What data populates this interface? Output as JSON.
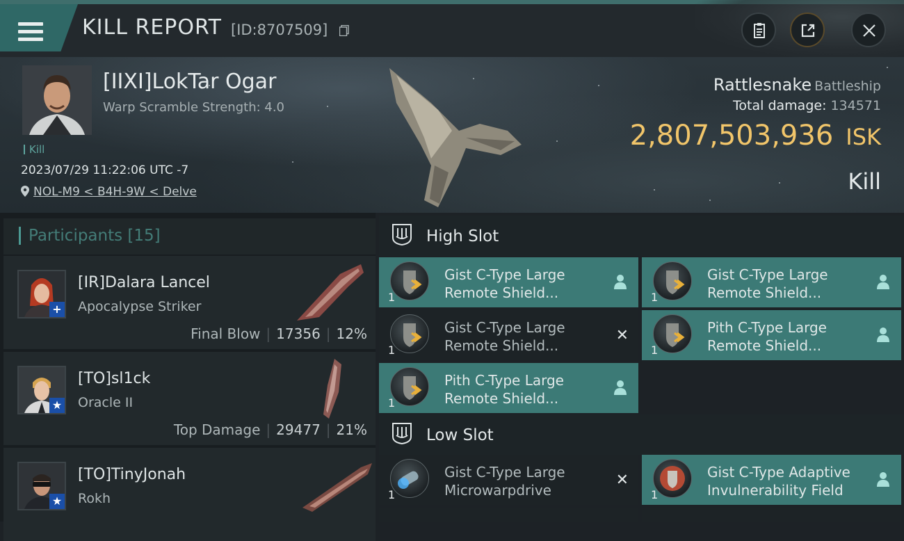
{
  "header": {
    "title": "KILL REPORT",
    "report_id": "[ID:8707509]",
    "icons": [
      "menu-icon",
      "copy-icon",
      "clipboard-icon",
      "share-icon",
      "close-icon"
    ]
  },
  "victim": {
    "name": "[IIXI]LokTar Ogar",
    "warp_scramble": "Warp Scramble Strength: 4.0",
    "kill_tag": "Kill",
    "datetime": "2023/07/29 11:22:06 UTC -7",
    "location": "NOL-M9 < B4H-9W < Delve",
    "ship_name": "Rattlesnake",
    "ship_class": "Battleship",
    "total_damage_label": "Total damage:",
    "total_damage_value": "134571",
    "isk_value": "2,807,503,936",
    "isk_unit": "ISK",
    "outcome": "Kill"
  },
  "participants": {
    "header": "Participants",
    "count": "[15]",
    "rows": [
      {
        "name": "[IR]Dalara Lancel",
        "ship": "Apocalypse Striker",
        "label": "Final Blow",
        "damage": "17356",
        "percent": "12%",
        "badge": "+"
      },
      {
        "name": "[TO]sl1ck",
        "ship": "Oracle II",
        "label": "Top Damage",
        "damage": "29477",
        "percent": "21%",
        "badge": "★"
      },
      {
        "name": "[TO]TinyJonah",
        "ship": "Rokh",
        "label": "",
        "damage": "",
        "percent": "",
        "badge": "★"
      }
    ]
  },
  "slots": {
    "high": {
      "title": "High Slot",
      "modules": [
        {
          "name": "Gist C-Type Large Remote Shield...",
          "qty": "1",
          "state": "dropped"
        },
        {
          "name": "Gist C-Type Large Remote Shield...",
          "qty": "1",
          "state": "dropped"
        },
        {
          "name": "Gist C-Type Large Remote Shield...",
          "qty": "1",
          "state": "destroyed"
        },
        {
          "name": "Pith C-Type Large Remote Shield...",
          "qty": "1",
          "state": "dropped"
        },
        {
          "name": "Pith C-Type Large Remote Shield...",
          "qty": "1",
          "state": "dropped"
        }
      ]
    },
    "low": {
      "title": "Low Slot",
      "modules": [
        {
          "name": "Gist C-Type Large Microwarpdrive",
          "qty": "1",
          "state": "destroyed"
        },
        {
          "name": "Gist C-Type Adaptive Invulnerability Field",
          "qty": "1",
          "state": "dropped"
        }
      ]
    }
  },
  "colors": {
    "accent": "#3c7a76",
    "isk": "#f1c56a",
    "badge": "#1a4fa8"
  }
}
